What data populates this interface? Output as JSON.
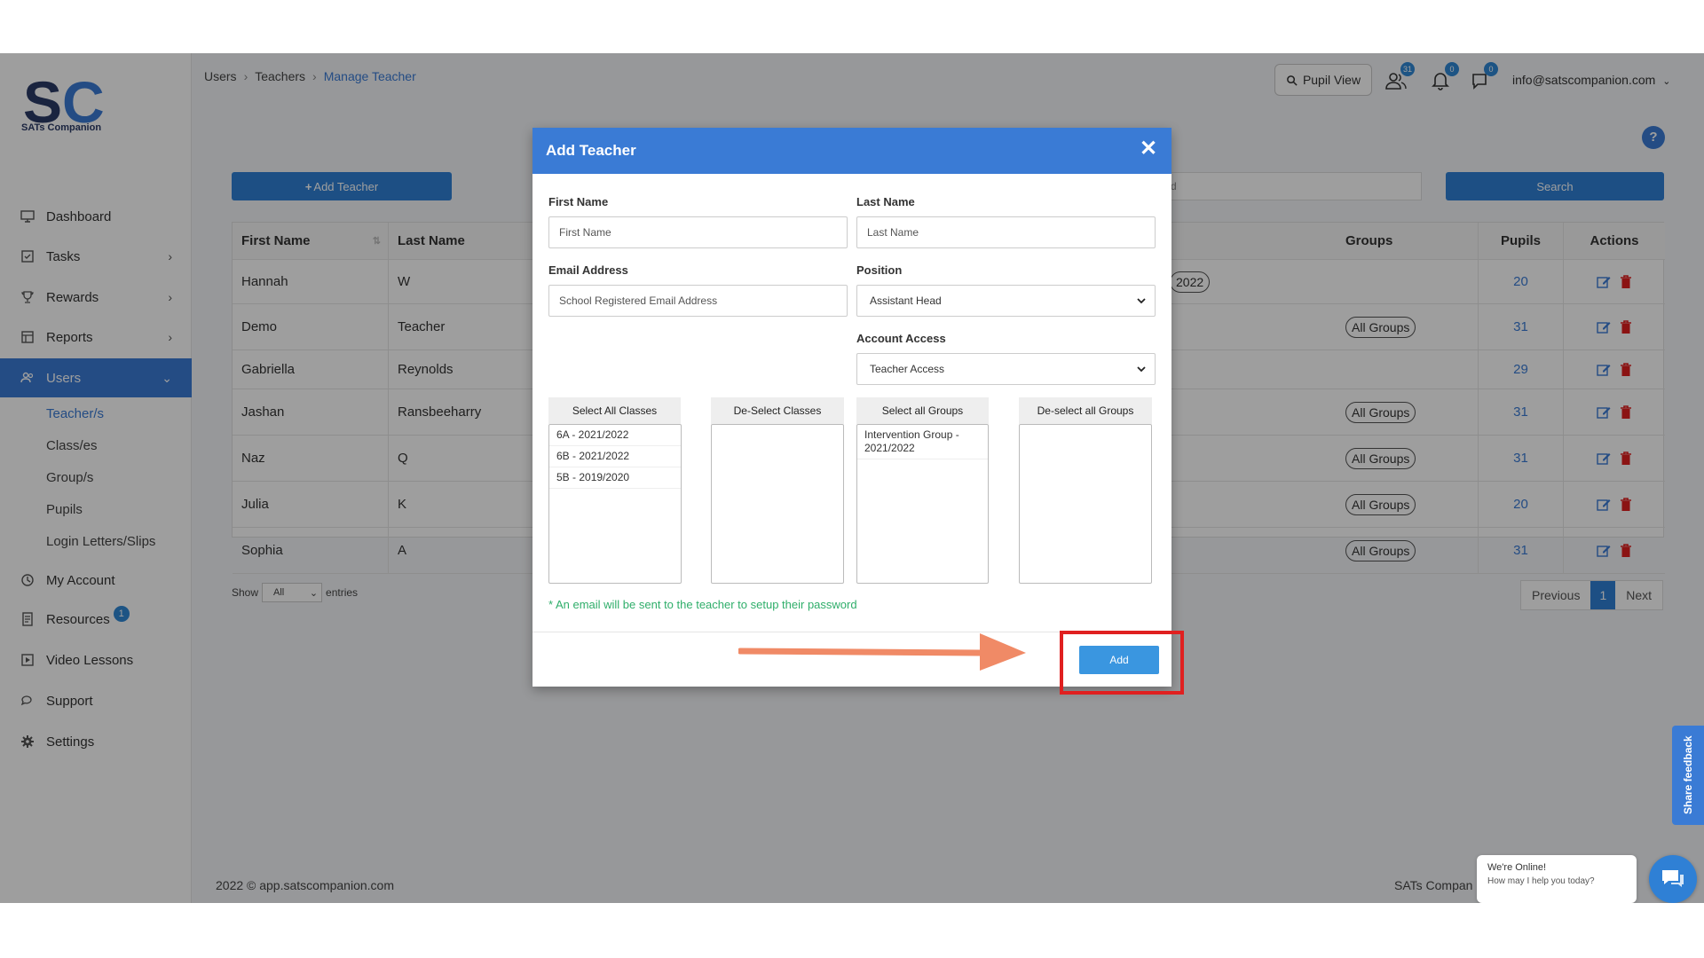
{
  "app": {
    "logo_initials": "SC",
    "logo_text": "SATs Companion"
  },
  "sidebar": {
    "items": [
      {
        "label": "Dashboard",
        "icon": "monitor-icon"
      },
      {
        "label": "Tasks",
        "icon": "tasks-icon"
      },
      {
        "label": "Rewards",
        "icon": "trophy-icon"
      },
      {
        "label": "Reports",
        "icon": "reports-icon"
      },
      {
        "label": "Users",
        "icon": "users-icon"
      },
      {
        "label": "My Account",
        "icon": "account-icon"
      },
      {
        "label": "Resources",
        "icon": "resources-icon",
        "badge": "1"
      },
      {
        "label": "Video Lessons",
        "icon": "video-icon"
      },
      {
        "label": "Support",
        "icon": "support-icon"
      },
      {
        "label": "Settings",
        "icon": "gear-icon"
      }
    ],
    "sub_items": [
      "Teacher/s",
      "Class/es",
      "Group/s",
      "Pupils",
      "Login Letters/Slips"
    ]
  },
  "breadcrumb": {
    "items": [
      "Users",
      "Teachers",
      "Manage Teacher"
    ]
  },
  "topbar": {
    "pupil_view": "Pupil View",
    "users_count": "31",
    "bell_count": "0",
    "chat_count": "0",
    "email": "info@satscompanion.com"
  },
  "help": "?",
  "toolbar": {
    "add_teacher": "Add Teacher",
    "search": "Search",
    "search_fragment": "d"
  },
  "table": {
    "headers": {
      "first_name": "First Name",
      "last_name": "Last Name",
      "groups": "Groups",
      "pupils": "Pupils",
      "actions": "Actions"
    },
    "rows": [
      {
        "first": "Hannah",
        "last": "W",
        "class_frag": "2022",
        "groups": "",
        "pupils": "20"
      },
      {
        "first": "Demo",
        "last": "Teacher",
        "class_frag": "",
        "groups": "All Groups",
        "pupils": "31"
      },
      {
        "first": "Gabriella",
        "last": "Reynolds",
        "class_frag": "",
        "groups": "",
        "pupils": "29"
      },
      {
        "first": "Jashan",
        "last": "Ransbeeharry",
        "class_frag": "",
        "groups": "All Groups",
        "pupils": "31"
      },
      {
        "first": "Naz",
        "last": "Q",
        "class_frag": "",
        "groups": "All Groups",
        "pupils": "31"
      },
      {
        "first": "Julia",
        "last": "K",
        "class_frag": "",
        "groups": "All Groups",
        "pupils": "20"
      },
      {
        "first": "Sophia",
        "last": "A",
        "class_frag": "",
        "groups": "All Groups",
        "pupils": "31"
      }
    ]
  },
  "entries": {
    "show": "Show",
    "value": "All",
    "suffix": "entries"
  },
  "pager": {
    "previous": "Previous",
    "page": "1",
    "next": "Next"
  },
  "footer": {
    "left": "2022 © app.satscompanion.com",
    "right": "SATs Compan"
  },
  "feedback": "Share feedback",
  "chat": {
    "line1": "We're Online!",
    "line2": "How may I help you today?"
  },
  "modal": {
    "title": "Add Teacher",
    "first_name_label": "First Name",
    "first_name_placeholder": "First Name",
    "last_name_label": "Last Name",
    "last_name_placeholder": "Last Name",
    "email_label": "Email Address",
    "email_placeholder": "School Registered Email Address",
    "position_label": "Position",
    "position_value": "Assistant Head",
    "access_label": "Account Access",
    "access_value": "Teacher Access",
    "select_all_classes": "Select All Classes",
    "deselect_classes": "De-Select Classes",
    "select_all_groups": "Select all Groups",
    "deselect_all_groups": "De-select all Groups",
    "classes": [
      "6A - 2021/2022",
      "6B - 2021/2022",
      "5B - 2019/2020"
    ],
    "groups": [
      "Intervention Group - 2021/2022"
    ],
    "note": "* An email will be sent to the teacher to setup their password",
    "add_button": "Add"
  }
}
